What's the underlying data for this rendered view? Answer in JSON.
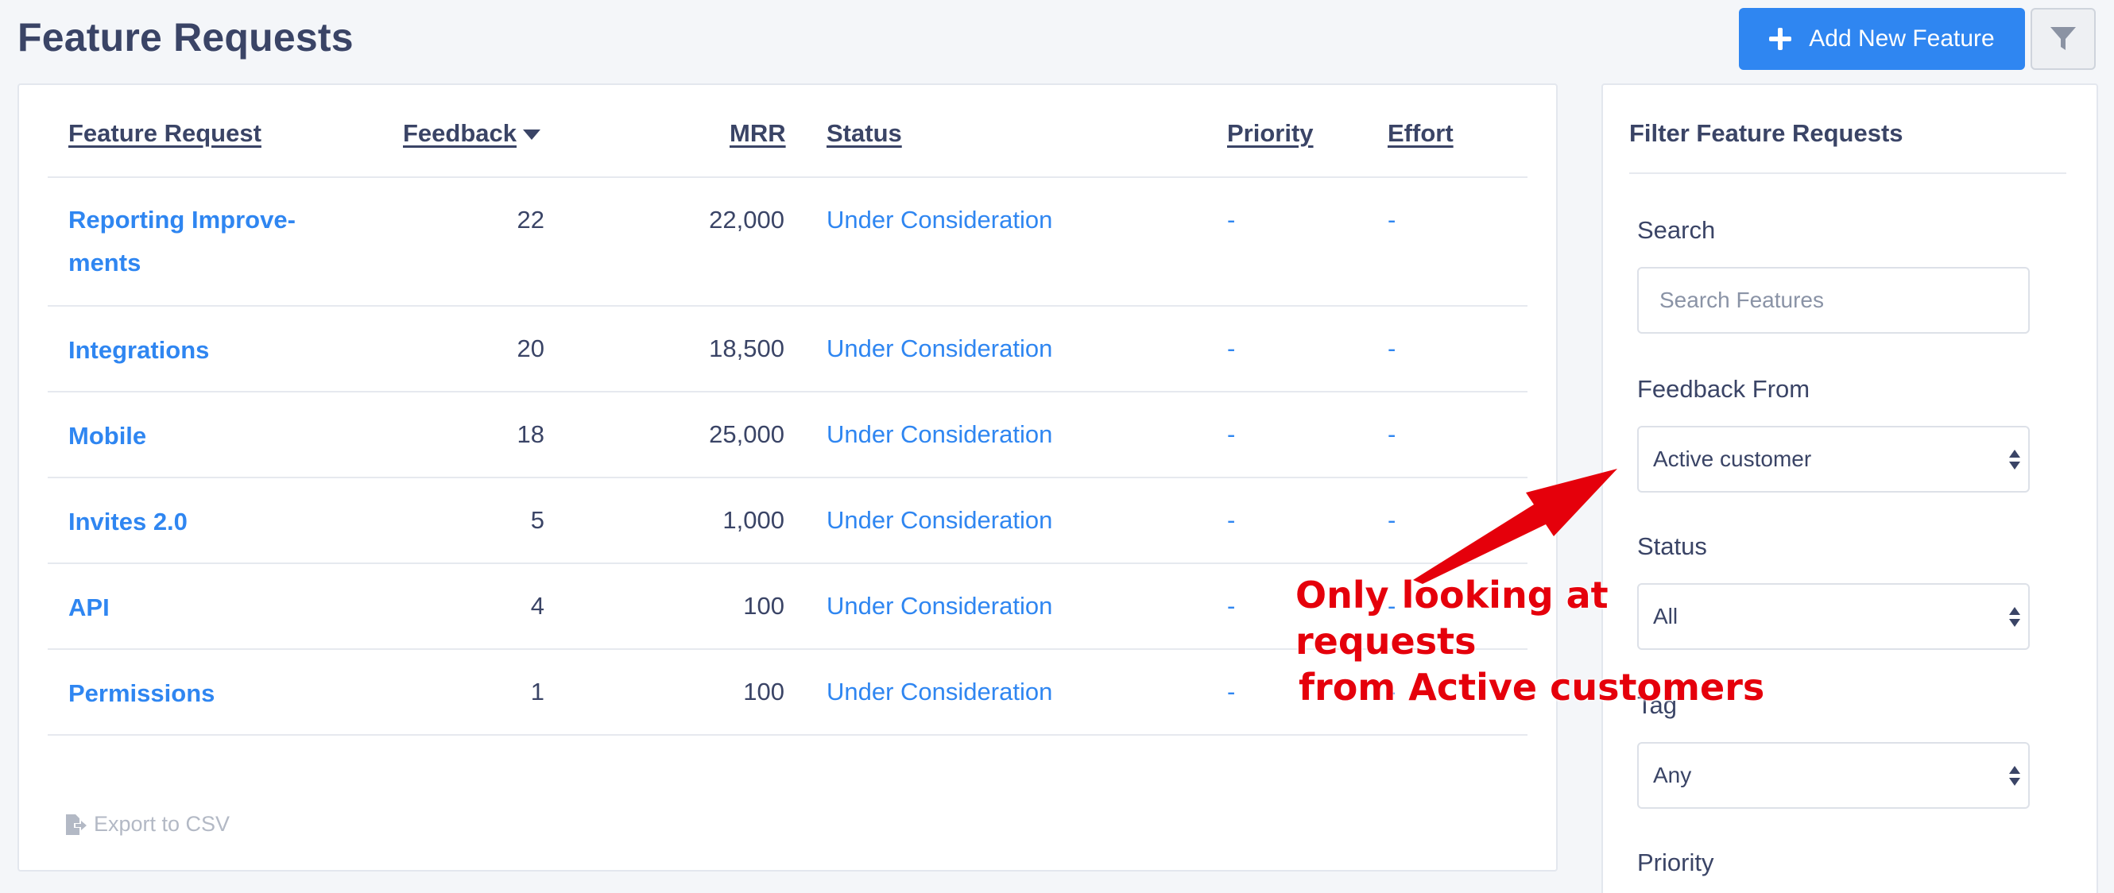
{
  "header": {
    "title": "Feature Requests",
    "add_button_label": "Add New Feature",
    "filter_toggle_icon": "filter-icon"
  },
  "table": {
    "columns": {
      "feature": "Feature Request",
      "feedback": "Feedback",
      "mrr": "MRR",
      "status": "Status",
      "priority": "Priority",
      "effort": "Effort"
    },
    "sort": {
      "column": "feedback",
      "direction": "desc"
    },
    "rows": [
      {
        "name": "Reporting Improve-\nments",
        "feedback": "22",
        "mrr": "22,000",
        "status": "Under Consideration",
        "priority": "-",
        "effort": "-"
      },
      {
        "name": "Integrations",
        "feedback": "20",
        "mrr": "18,500",
        "status": "Under Consideration",
        "priority": "-",
        "effort": "-"
      },
      {
        "name": "Mobile",
        "feedback": "18",
        "mrr": "25,000",
        "status": "Under Consideration",
        "priority": "-",
        "effort": "-"
      },
      {
        "name": "Invites 2.0",
        "feedback": "5",
        "mrr": "1,000",
        "status": "Under Consideration",
        "priority": "-",
        "effort": "-"
      },
      {
        "name": "API",
        "feedback": "4",
        "mrr": "100",
        "status": "Under Consideration",
        "priority": "-",
        "effort": "-"
      },
      {
        "name": "Permissions",
        "feedback": "1",
        "mrr": "100",
        "status": "Under Consideration",
        "priority": "-",
        "effort": "-"
      }
    ],
    "export_label": "Export to CSV"
  },
  "filter": {
    "title": "Filter Feature Requests",
    "search_label": "Search",
    "search_placeholder": "Search Features",
    "feedback_from_label": "Feedback From",
    "feedback_from_value": "Active customer",
    "status_label": "Status",
    "status_value": "All",
    "tag_label": "Tag",
    "tag_value": "Any",
    "priority_label": "Priority"
  },
  "annotation": {
    "line1": "Only looking at requests",
    "line2": "from Active customers",
    "color": "#e5000b"
  },
  "colors": {
    "accent": "#2f86f1",
    "text": "#3a4466",
    "background": "#f4f6f9"
  }
}
